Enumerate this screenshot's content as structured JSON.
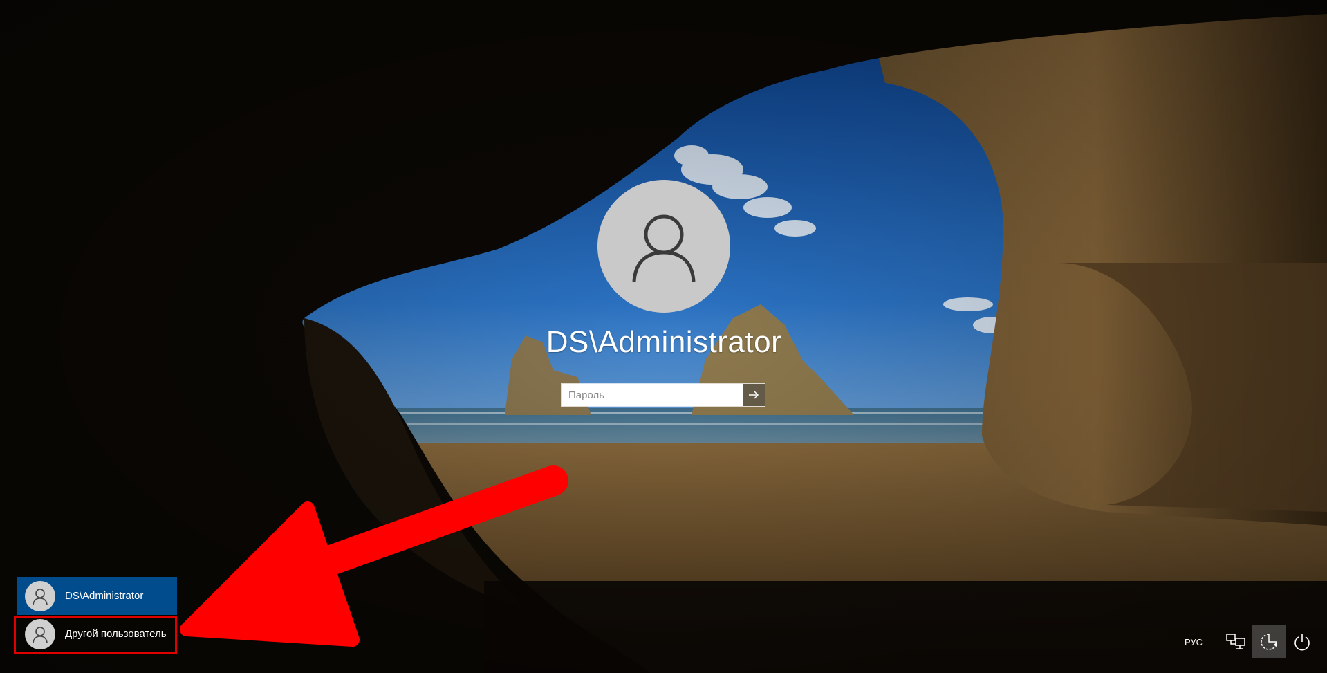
{
  "login": {
    "username": "DS\\Administrator",
    "password_placeholder": "Пароль"
  },
  "user_list": [
    {
      "label": "DS\\Administrator",
      "selected": true
    },
    {
      "label": "Другой пользователь",
      "selected": false
    }
  ],
  "bottom_bar": {
    "language": "РУС",
    "icons": [
      "network-icon",
      "ease-of-access-icon",
      "power-icon"
    ]
  },
  "colors": {
    "selected_user_bg": "#004c8c",
    "highlight": "#e00000",
    "avatar_bg": "#c9c9c9"
  }
}
